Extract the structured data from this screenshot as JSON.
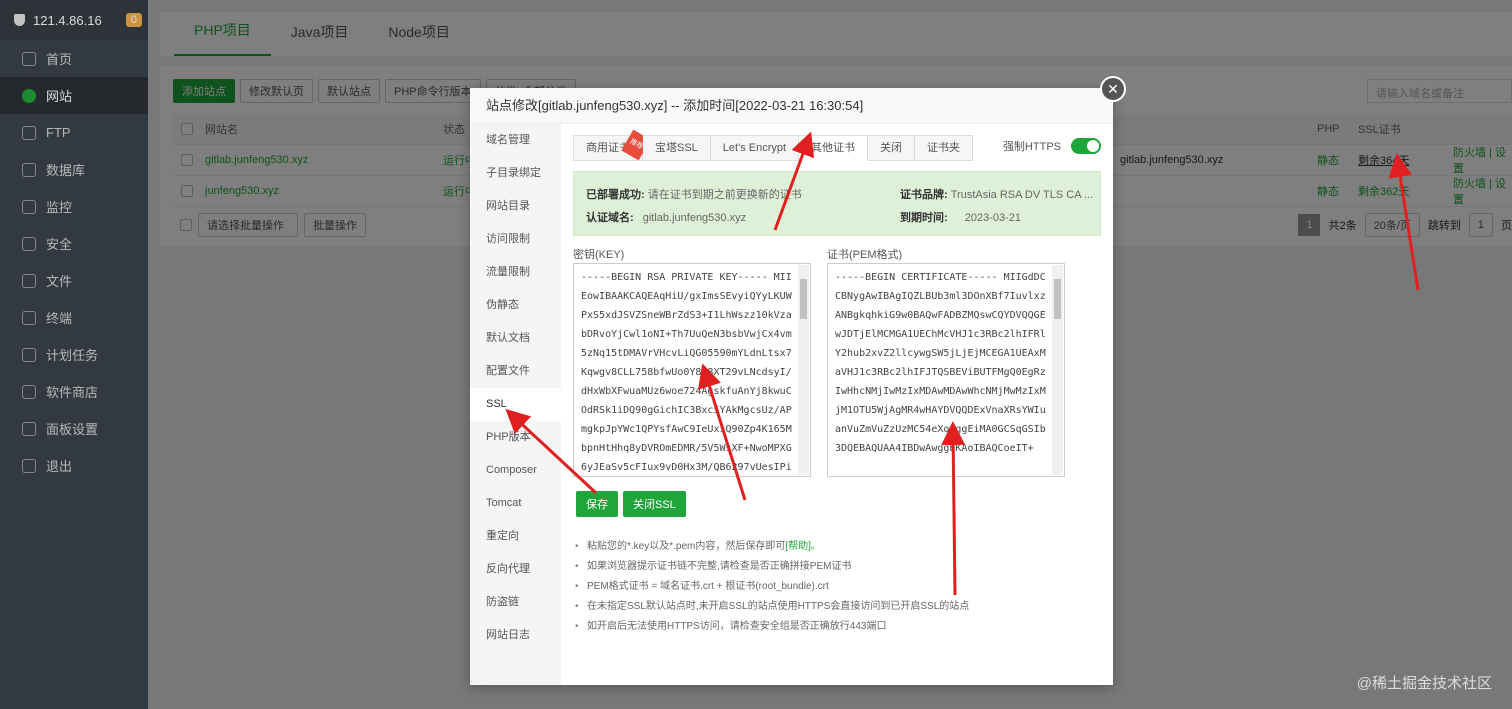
{
  "sidebar": {
    "ip": "121.4.86.16",
    "badge": "0",
    "items": [
      {
        "label": "首页"
      },
      {
        "label": "网站"
      },
      {
        "label": "FTP"
      },
      {
        "label": "数据库"
      },
      {
        "label": "监控"
      },
      {
        "label": "安全"
      },
      {
        "label": "文件"
      },
      {
        "label": "终端"
      },
      {
        "label": "计划任务"
      },
      {
        "label": "软件商店"
      },
      {
        "label": "面板设置"
      },
      {
        "label": "退出"
      }
    ]
  },
  "top_tabs": [
    "PHP项目",
    "Java项目",
    "Node项目"
  ],
  "toolbar": {
    "add_site": "添加站点",
    "modify_default_page": "修改默认页",
    "default_site": "默认站点",
    "php_cli": "PHP命令行版本",
    "cut": "分类: 全部分类",
    "search_placeholder": "请输入域名或备注"
  },
  "table": {
    "headers": {
      "name": "网站名",
      "status": "状态",
      "php": "PHP",
      "ssl": "SSL证书"
    },
    "rows": [
      {
        "name": "gitlab.junfeng530.xyz",
        "status": "运行中",
        "remark": "gitlab.junfeng530.xyz",
        "php": "静态",
        "ssl": "剩余364天",
        "actions": "防火墙 | 设置"
      },
      {
        "name": "junfeng530.xyz",
        "status": "运行中",
        "php": "静态",
        "ssl": "剩余362天",
        "actions": "防火墙 | 设置"
      }
    ],
    "batch_select": "请选择批量操作",
    "batch_button": "批量操作",
    "pager": {
      "current": "1",
      "total": "共2条",
      "per_page": "20条/页",
      "goto": "跳转到",
      "goto_page": "1",
      "page_suffix": "页"
    }
  },
  "modal": {
    "title": "站点修改[gitlab.junfeng530.xyz] -- 添加时间[2022-03-21 16:30:54]",
    "menu": [
      "域名管理",
      "子目录绑定",
      "网站目录",
      "访问限制",
      "流量限制",
      "伪静态",
      "默认文档",
      "配置文件",
      "SSL",
      "PHP版本",
      "Composer",
      "Tomcat",
      "重定向",
      "反向代理",
      "防盗链",
      "网站日志"
    ],
    "ssl_tabs": [
      "商用证书",
      "宝塔SSL",
      "Let's Encrypt",
      "其他证书",
      "关闭",
      "证书夹"
    ],
    "ribbon": "推荐",
    "force_https": "强制HTTPS",
    "info": {
      "deployed_label": "已部署成功:",
      "deployed_text": "请在证书到期之前更换新的证书",
      "domain_label": "认证域名:",
      "domain_value": "gitlab.junfeng530.xyz",
      "brand_label": "证书品牌:",
      "brand_value": "TrustAsia RSA DV TLS CA ...",
      "expiry_label": "到期时间:",
      "expiry_value": "2023-03-21"
    },
    "key_label": "密钥(KEY)",
    "cert_label": "证书(PEM格式)",
    "key_text": "-----BEGIN RSA PRIVATE KEY----- MIIEowIBAAKCAQEAqHiU/gxImsSEvyiQYyLKUWPxS5xdJSVZSneWBrZdS3+I1LhWszz10kVzabDRvoYjCwl1oNI+Th7UuQeN3bsbVwjCx4vm5zNq15tDMAVrVHcvLiQG05590mYLdnLtsx7Kqwgv8CLL758bfwUo0Y8R8XT29vLNcdsyI/dHxWbXFwuaMUz6woe724AgskfuAnYj8kwuCOdRSk1iDQ90gGichIC3Bxc5YAkMgcsUz/APmgkpJpYWc1QPYsfAwC9IeUxiQ90Zp4K165MbpnHtHhq8yDVROmEDMR/5V5WsXF+NwoMPXG6yJEaSv5cFIux9vD0Hx3M/QB6297vUesIPiFKEw",
    "cert_text": "-----BEGIN CERTIFICATE----- MIIGdDCCBNygAwIBAgIQZLBUb3ml3DOnXBf7IuvlxzANBgkqhkiG9w0BAQwFADBZMQswCQYDVQQGEwJDTjElMCMGA1UEChMcVHJ1c3RBc2lhIFRlY2hub2xvZ2llcywgSW5jLjEjMCEGA1UEAxMaVHJ1c3RBc2lhIFJTQSBEViBUTFMgQ0EgRzIwHhcNMjIwMzIxMDAwMDAwWhcNMjMwMzIxMjM1OTU5WjAgMR4wHAYDVQQDExVnaXRsYWIuanVuZmVuZzUzMC54eXowggEiMA0GCSqGSIb3DQEBAQUAA4IBDwAwggEKAoIBAQCoeIT+",
    "save": "保存",
    "close_ssl": "关闭SSL",
    "tips": [
      {
        "text": "粘贴您的*.key以及*.pem内容，然后保存即可",
        "help": "[帮助]。"
      },
      {
        "text": "如果浏览器提示证书链不完整,请检查是否正确拼接PEM证书"
      },
      {
        "text": "PEM格式证书 = 域名证书.crt + 根证书(root_bundle).crt"
      },
      {
        "text": "在未指定SSL默认站点时,未开启SSL的站点使用HTTPS会直接访问到已开启SSL的站点"
      },
      {
        "text": "如开启后无法使用HTTPS访问，请检查安全组是否正确放行443端口"
      }
    ]
  },
  "watermark": "@稀土掘金技术社区",
  "colors": {
    "accent": "#20a53a",
    "arrow": "#e02020",
    "sidebar_bg": "#3c444d"
  }
}
